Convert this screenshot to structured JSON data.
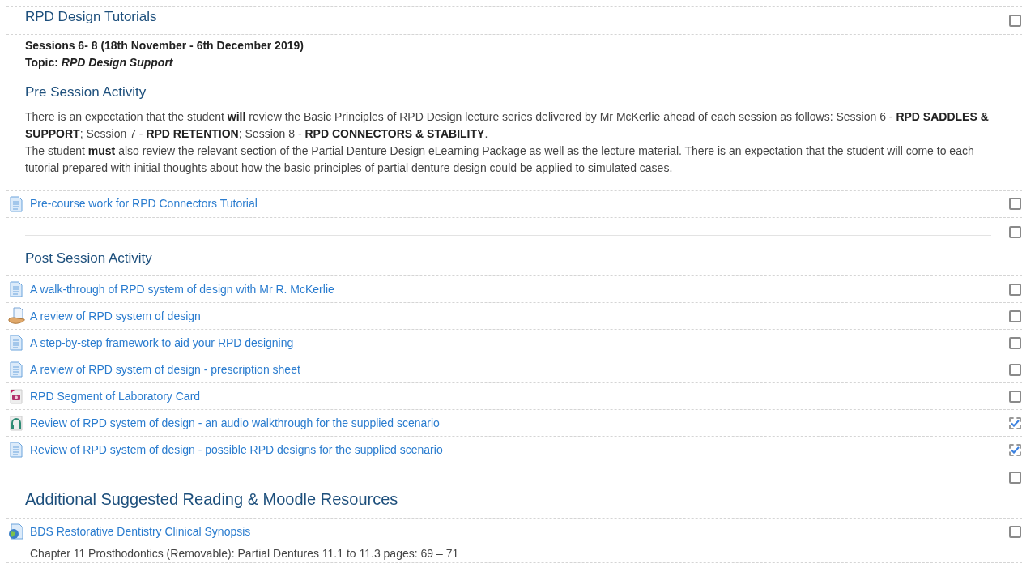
{
  "title_section": {
    "heading": "RPD Design Tutorials",
    "checked": false
  },
  "intro": {
    "sessions": "Sessions 6- 8 (18th November - 6th December 2019)",
    "topic": "Topic: *RPD Design Support*",
    "heading": "Pre Session Activity",
    "paragraphs": [
      "There is an expectation that the student **will** review the Basic Principles of RPD Design lecture series delivered by Mr McKerlie ahead of each session as follows: Session 6 - **RPD SADDLES & SUPPORT**; Session 7 - **RPD RETENTION**; Session 8 - **RPD CONNECTORS & STABILITY**.",
      "The student **must** also review the relevant section of the Partial Denture Design eLearning Package as well as the lecture material. There is an expectation that the student will come to each tutorial prepared with initial thoughts about how the basic principles of partial denture design could be applied to simulated cases."
    ]
  },
  "pre_activities": [
    {
      "kind": "page",
      "title": "Pre-course work for RPD Connectors Tutorial",
      "checked": false
    }
  ],
  "post_section": {
    "heading": "Post Session Activity",
    "checked": false
  },
  "post_activities": [
    {
      "kind": "page",
      "title": "A walk-through of RPD system of design with Mr R. McKerlie",
      "checked": false
    },
    {
      "kind": "file",
      "title": "A review of RPD system of design",
      "checked": false
    },
    {
      "kind": "page",
      "title": "A step-by-step framework to aid your RPD designing",
      "checked": false
    },
    {
      "kind": "page",
      "title": "A review of RPD system of design - prescription sheet",
      "checked": false
    },
    {
      "kind": "image",
      "title": "RPD Segment of Laboratory Card",
      "checked": false
    },
    {
      "kind": "audio",
      "title": "Review of RPD system of design - an audio walkthrough for the supplied scenario",
      "checked": true
    },
    {
      "kind": "page",
      "title": "Review of RPD system of design - possible RPD designs for the supplied scenario",
      "checked": true
    }
  ],
  "reading_section": {
    "heading": "Additional Suggested Reading & Moodle Resources",
    "checked": false
  },
  "reading_activities": [
    {
      "kind": "url",
      "title": "BDS Restorative Dentistry Clinical Synopsis",
      "checked": false,
      "description": "Chapter 11 Prosthodontics (Removable): Partial Dentures 11.1 to 11.3 pages: 69 – 71"
    }
  ]
}
